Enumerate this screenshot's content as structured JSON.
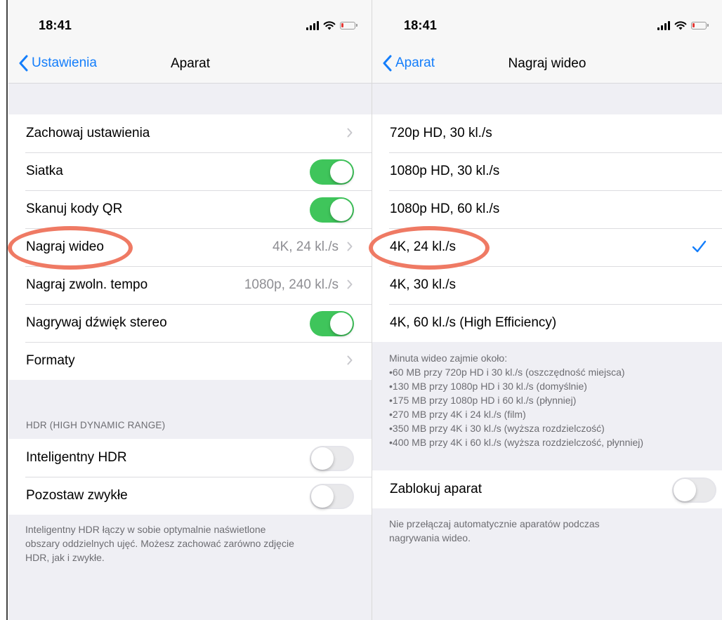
{
  "colors": {
    "accent": "#147efb",
    "toggle_on": "#3fc55b",
    "annotation": "#ef7a64",
    "secondary_text": "#8e8e93"
  },
  "left": {
    "status": {
      "time": "18:41"
    },
    "nav": {
      "back_label": "Ustawienia",
      "title": "Aparat"
    },
    "main_rows": [
      {
        "label": "Zachowaj ustawienia",
        "value": "",
        "control": "chevron"
      },
      {
        "label": "Siatka",
        "value": "",
        "control": "toggle-on"
      },
      {
        "label": "Skanuj kody QR",
        "value": "",
        "control": "toggle-on"
      },
      {
        "label": "Nagraj wideo",
        "value": "4K, 24 kl./s",
        "control": "chevron"
      },
      {
        "label": "Nagraj zwoln. tempo",
        "value": "1080p, 240 kl./s",
        "control": "chevron"
      },
      {
        "label": "Nagrywaj dźwięk stereo",
        "value": "",
        "control": "toggle-on"
      },
      {
        "label": "Formaty",
        "value": "",
        "control": "chevron"
      }
    ],
    "hdr_header": "HDR (HIGH DYNAMIC RANGE)",
    "hdr_rows": [
      {
        "label": "Inteligentny HDR",
        "control": "toggle-off"
      },
      {
        "label": "Pozostaw zwykłe",
        "control": "toggle-off"
      }
    ],
    "hdr_footer": [
      "Inteligentny HDR łączy w sobie optymalnie naświetlone",
      "obszary oddzielnych ujęć. Możesz zachować zarówno zdjęcie",
      "HDR, jak i zwykłe."
    ]
  },
  "right": {
    "status": {
      "time": "18:41"
    },
    "nav": {
      "back_label": "Aparat",
      "title": "Nagraj wideo"
    },
    "video_options": [
      {
        "label": "720p HD, 30 kl./s",
        "selected": false
      },
      {
        "label": "1080p HD, 30 kl./s",
        "selected": false
      },
      {
        "label": "1080p HD, 60 kl./s",
        "selected": false
      },
      {
        "label": "4K, 24 kl./s",
        "selected": true
      },
      {
        "label": "4K, 30 kl./s",
        "selected": false
      },
      {
        "label": "4K, 60 kl./s (High Efficiency)",
        "selected": false
      }
    ],
    "size_note_title": "Minuta wideo zajmie około:",
    "size_notes": [
      "60 MB przy 720p HD i 30 kl./s (oszczędność miejsca)",
      "130 MB przy 1080p HD i 30 kl./s (domyślnie)",
      "175 MB przy 1080p HD i 60 kl./s (płynniej)",
      "270 MB przy 4K i 24 kl./s (film)",
      "350 MB przy 4K i 30 kl./s (wyższa rozdzielczość)",
      "400 MB przy 4K i 60 kl./s (wyższa rozdzielczość, płynniej)"
    ],
    "lock_row": {
      "label": "Zablokuj aparat",
      "control": "toggle-off"
    },
    "lock_footer": [
      "Nie przełączaj automatycznie aparatów podczas",
      "nagrywania wideo."
    ]
  }
}
